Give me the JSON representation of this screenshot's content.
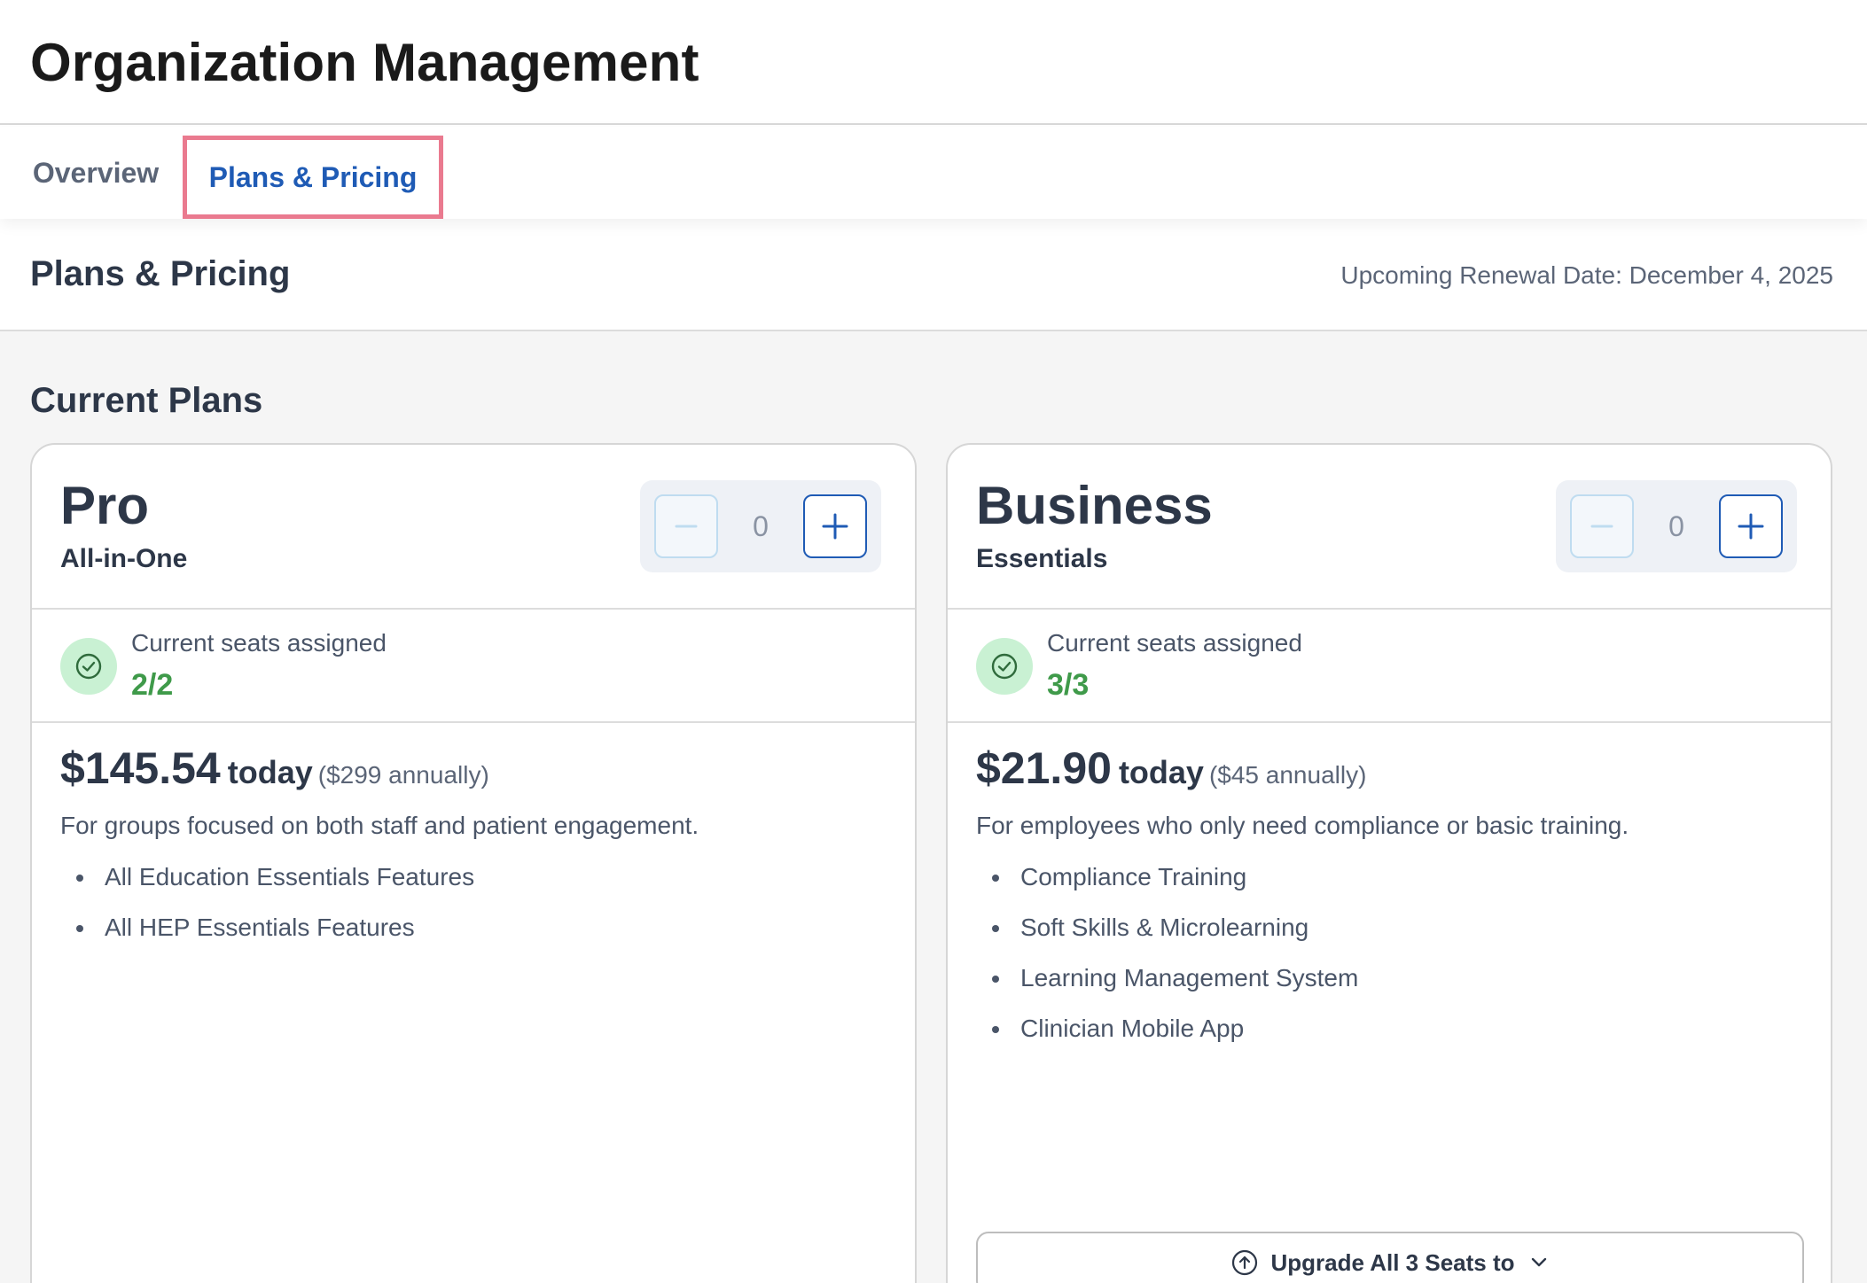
{
  "app": {
    "title": "Organization Management"
  },
  "tabs": [
    {
      "label": "Overview",
      "active": false
    },
    {
      "label": "Plans & Pricing",
      "active": true
    }
  ],
  "section": {
    "title": "Plans & Pricing",
    "renewal": "Upcoming Renewal Date: December 4, 2025"
  },
  "current_plans": {
    "title": "Current Plans",
    "plans": [
      {
        "name": "Pro",
        "subtitle": "All-in-One",
        "stepper_value": "0",
        "seats_label": "Current seats assigned",
        "seats_value": "2/2",
        "price_today": "$145.54",
        "today_label": "today",
        "price_annual": "($299 annually)",
        "description": "For groups focused on both staff and patient engagement.",
        "features": [
          "All Education Essentials Features",
          "All HEP Essentials Features"
        ]
      },
      {
        "name": "Business",
        "subtitle": "Essentials",
        "stepper_value": "0",
        "seats_label": "Current seats assigned",
        "seats_value": "3/3",
        "price_today": "$21.90",
        "today_label": "today",
        "price_annual": "($45 annually)",
        "description": "For employees who only need compliance or basic training.",
        "features": [
          "Compliance Training",
          "Soft Skills & Microlearning",
          "Learning Management System",
          "Clinician Mobile App"
        ],
        "upgrade_label": "Upgrade All 3 Seats to"
      }
    ]
  },
  "icons": {
    "minus": "minus-icon",
    "plus": "plus-icon",
    "check": "check-circle-icon",
    "upgrade": "arrow-up-circle-icon",
    "chevron": "chevron-down-icon"
  },
  "colors": {
    "accent": "#1f5bb5",
    "tab_highlight": "#ea7a8f",
    "success": "#3f9a4a",
    "success_bg": "#c9f1d3"
  }
}
